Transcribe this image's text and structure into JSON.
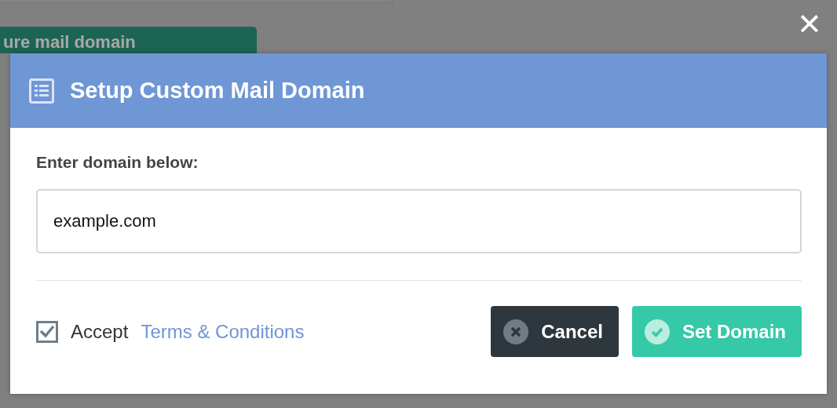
{
  "background_page": {
    "button_label": "ure mail domain"
  },
  "close_label": "✕",
  "modal": {
    "title": "Setup Custom Mail Domain",
    "field_label": "Enter domain below:",
    "domain_field": {
      "value": "example.com"
    },
    "terms": {
      "checked": true,
      "prefix": "Accept",
      "link": "Terms & Conditions"
    },
    "buttons": [
      {
        "label": "Cancel",
        "kind": "cancel"
      },
      {
        "label": "Set Domain",
        "kind": "confirm"
      }
    ]
  }
}
